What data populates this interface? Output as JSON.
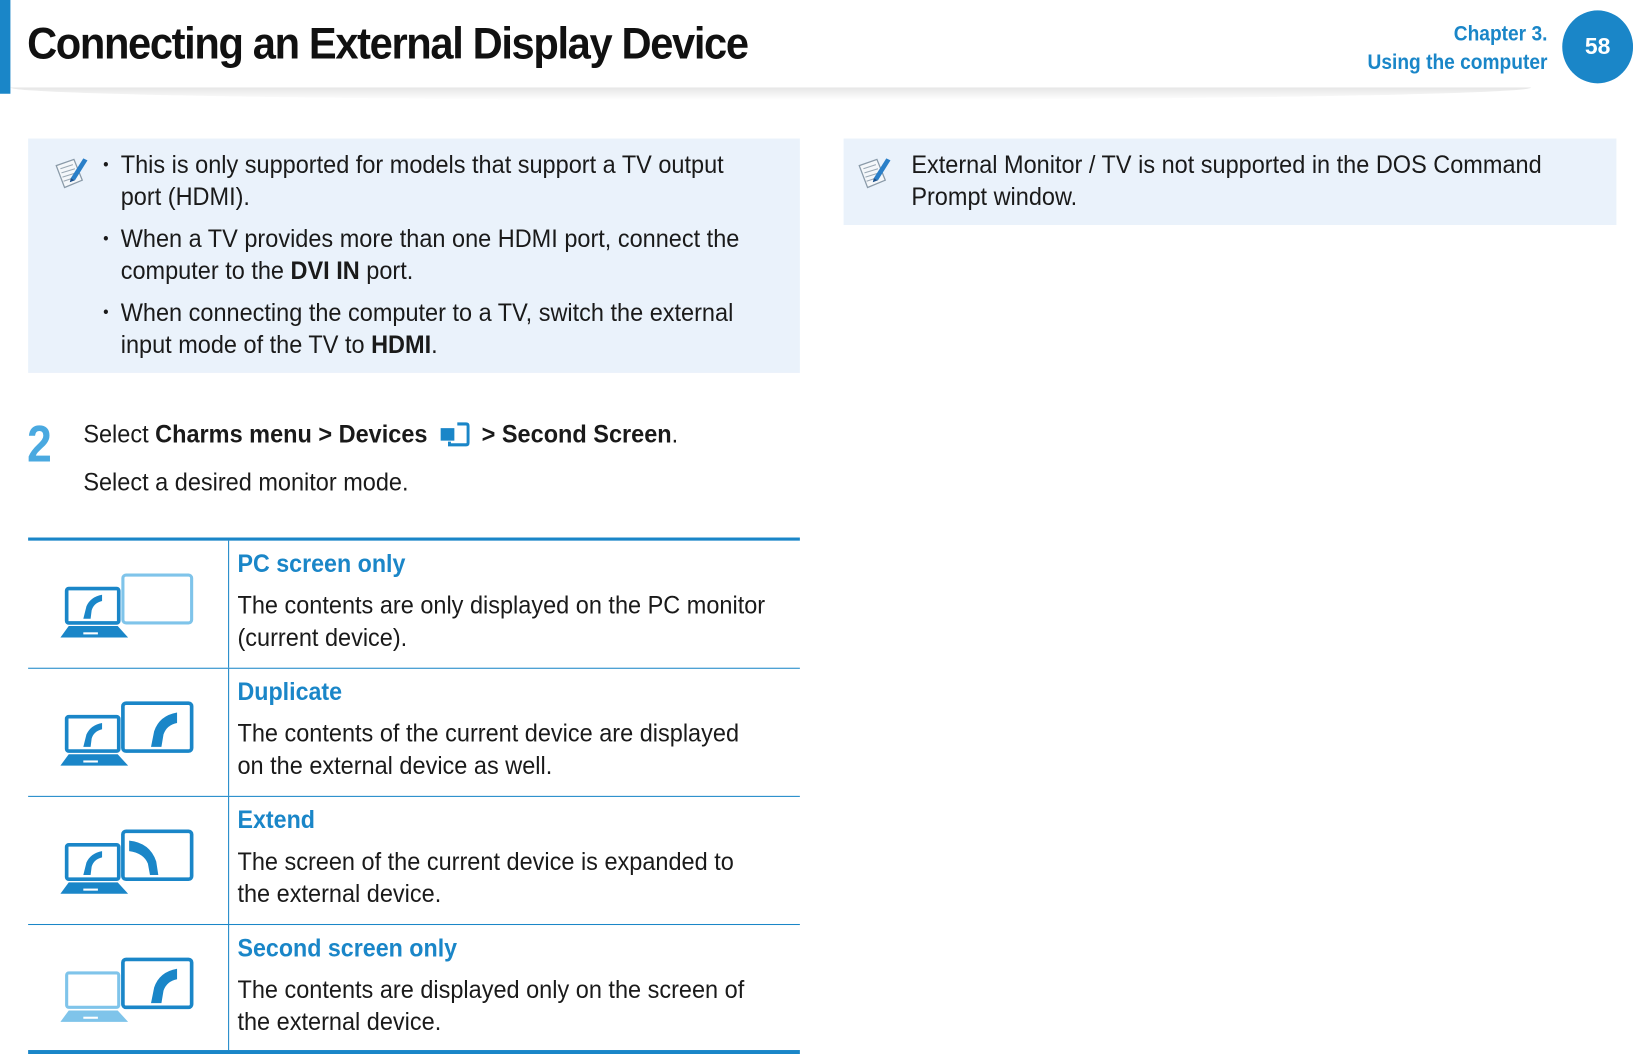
{
  "header": {
    "title": "Connecting an External Display Device",
    "chapter_line1": "Chapter 3.",
    "chapter_line2": "Using the computer",
    "page_number": "58"
  },
  "note_left": {
    "icon": "note-pencil-icon",
    "items": [
      {
        "text_before": "This is only supported for models that support a TV output port (HDMI).",
        "bold": "",
        "text_after": ""
      },
      {
        "text_before": "When a TV provides more than one HDMI port, connect the computer to the ",
        "bold": "DVI IN",
        "text_after": " port."
      },
      {
        "text_before": "When connecting the computer to a TV, switch the external input mode of the TV to ",
        "bold": "HDMI",
        "text_after": "."
      }
    ]
  },
  "note_right": {
    "icon": "note-pencil-icon",
    "text": "External Monitor / TV is not supported in the DOS Command Prompt window."
  },
  "step": {
    "number": "2",
    "select_label": "Select ",
    "path_part1": "Charms menu > Devices",
    "devices_icon": "devices-icon",
    "path_part2": "> Second Screen",
    "period": ".",
    "instruction": "Select a desired monitor mode."
  },
  "modes": [
    {
      "name": "PC screen only",
      "description": "The contents are only displayed on the PC monitor (current device).",
      "icon": "pc-screen-only-icon"
    },
    {
      "name": "Duplicate",
      "description": "The contents of the current device are displayed on the external device as well.",
      "icon": "duplicate-icon"
    },
    {
      "name": "Extend",
      "description": "The screen of the current device is expanded to the external device.",
      "icon": "extend-icon"
    },
    {
      "name": "Second screen only",
      "description": "The contents are displayed only on the screen of the external device.",
      "icon": "second-screen-only-icon"
    }
  ],
  "colors": {
    "accent": "#1a86c8",
    "accent_light": "#7fc4ea",
    "note_background": "#eaf2fb",
    "step_number": "#4aa9e0"
  }
}
